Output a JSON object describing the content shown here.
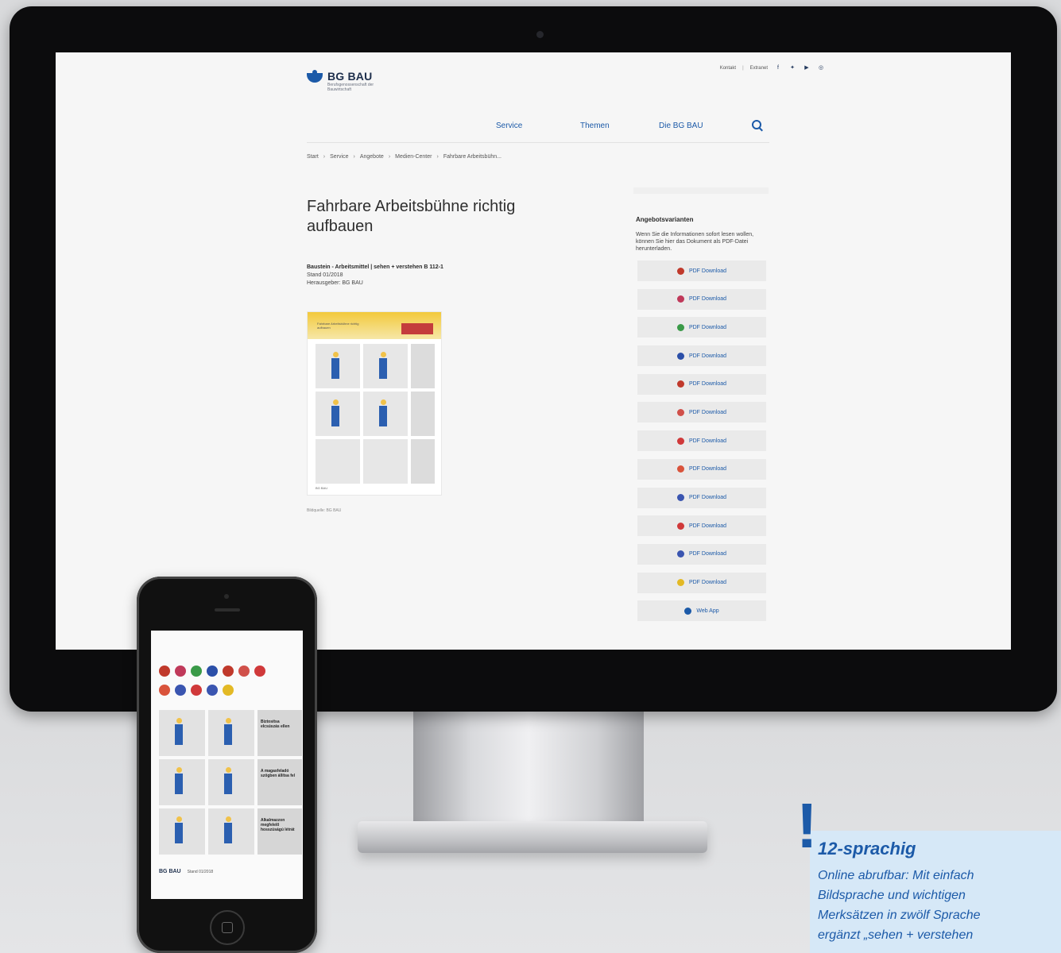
{
  "site": {
    "logo_name": "BG BAU",
    "logo_sub": "Berufsgenossenschaft der Bauwirtschaft",
    "meta_nav": [
      "Kontakt",
      "Extranet"
    ],
    "social_icons": [
      "facebook-icon",
      "twitter-icon",
      "youtube-icon",
      "instagram-icon"
    ],
    "nav": [
      "Service",
      "Themen",
      "Die BG BAU"
    ],
    "breadcrumb": [
      "Start",
      "Service",
      "Angebote",
      "Medien-Center",
      "Fahrbare Arbeitsbühn..."
    ],
    "title": "Fahrbare Arbeitsbühne richtig aufbauen",
    "pub_line1": "Baustein - Arbeitsmittel | sehen + verstehen B 112-1",
    "pub_line2": "Stand 01/2018",
    "pub_line3": "Herausgeber: BG BAU",
    "doc_title": "Fahrbare Arbeitsbühne richtig aufbauen",
    "caption": "Bildquelle: BG BAU",
    "sidebar_heading": "Angebotsvarianten",
    "sidebar_text": "Wenn Sie die Informationen sofort lesen wollen, können Sie hier das Dokument als PDF-Datei herunterladen.",
    "downloads": [
      {
        "label": "PDF Download",
        "flag": "#c0392b"
      },
      {
        "label": "PDF Download",
        "flag": "#c0395a"
      },
      {
        "label": "PDF Download",
        "flag": "#3a9a48"
      },
      {
        "label": "PDF Download",
        "flag": "#2b4fa8"
      },
      {
        "label": "PDF Download",
        "flag": "#c0392b"
      },
      {
        "label": "PDF Download",
        "flag": "#d0504a"
      },
      {
        "label": "PDF Download",
        "flag": "#d0393a"
      },
      {
        "label": "PDF Download",
        "flag": "#d9533b"
      },
      {
        "label": "PDF Download",
        "flag": "#3a55b0"
      },
      {
        "label": "PDF Download",
        "flag": "#d0393a"
      },
      {
        "label": "PDF Download",
        "flag": "#3a55b0"
      },
      {
        "label": "PDF Download",
        "flag": "#e3b925"
      }
    ],
    "webapp_label": "Web App"
  },
  "phone": {
    "flags_row1": [
      "#c0392b",
      "#c0395a",
      "#3a9a48",
      "#2b4fa8",
      "#c0392b",
      "#d0504a",
      "#d0393a"
    ],
    "flags_row2": [
      "#d9533b",
      "#3a55b0",
      "#d0393a",
      "#3a55b0",
      "#e3b925"
    ],
    "text1": "Biztosítsa elcsúszás ellen",
    "text2": "A magasfeladó szögben állítsa fel",
    "text3": "Alkalmazzon megfelelő hosszúságú létrát",
    "logo": "BG BAU",
    "stand": "Stand 01/2018"
  },
  "note": {
    "mark": "!",
    "title": "12-sprachig",
    "line1": "Online abrufbar: Mit einfach",
    "line2": "Bildsprache und wichtigen",
    "line3": "Merksätzen in zwölf Sprache",
    "line4": "ergänzt „sehen + verstehen"
  }
}
